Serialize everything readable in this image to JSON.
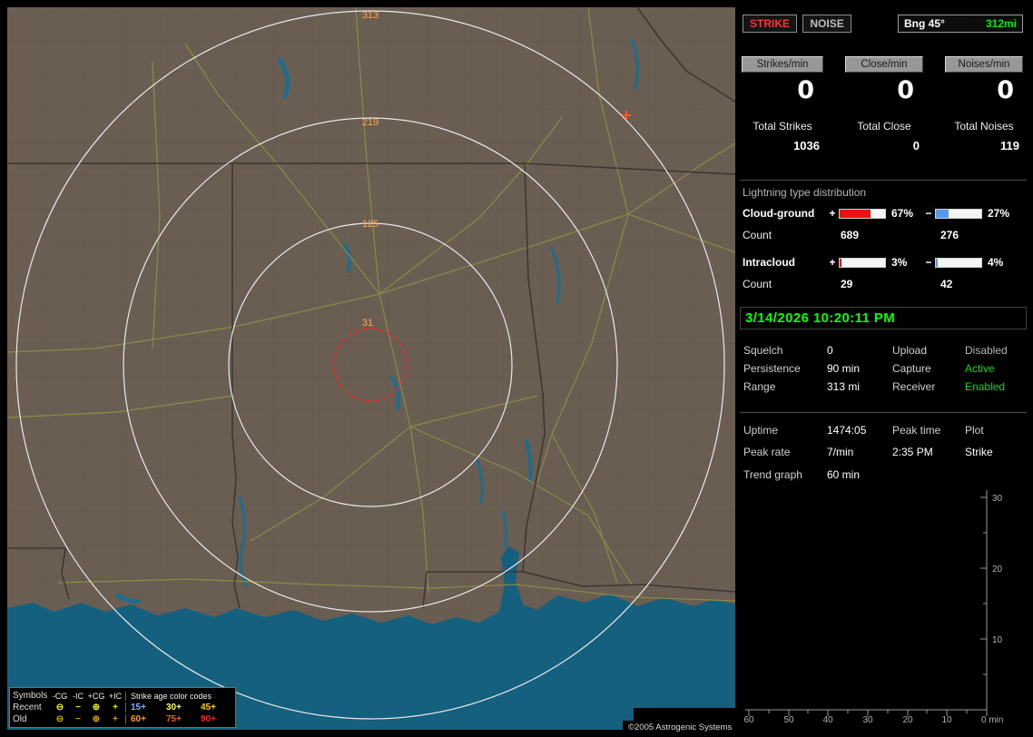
{
  "map": {
    "credit": "©2005 Astrogenic Systems",
    "rings": [
      {
        "label": "313"
      },
      {
        "label": "219"
      },
      {
        "label": "125"
      },
      {
        "label": "31"
      }
    ],
    "legend": {
      "symbols_title": "Symbols",
      "symbol_columns": [
        "-CG",
        "-IC",
        "+CG",
        "+IC"
      ],
      "symbols": {
        "neg_cg": "⊖",
        "neg_ic": "−",
        "pos_cg": "⊕",
        "pos_ic": "+"
      },
      "age_title": "Strike age color codes",
      "rows": [
        {
          "label": "Recent",
          "symbol_color": "#e8f000",
          "ages": [
            {
              "text": "15+",
              "color": "#7fb2ff"
            },
            {
              "text": "30+",
              "color": "#ffff55"
            },
            {
              "text": "45+",
              "color": "#ffcc00"
            }
          ]
        },
        {
          "label": "Old",
          "symbol_color": "#cfa400",
          "ages": [
            {
              "text": "60+",
              "color": "#ff9933"
            },
            {
              "text": "75+",
              "color": "#ff5533"
            },
            {
              "text": "90+",
              "color": "#ff2222"
            }
          ]
        }
      ]
    }
  },
  "panel": {
    "modes": [
      {
        "label": "STRIKE",
        "color": "#ff3333"
      },
      {
        "label": "NOISE",
        "color": "#bdbdbd"
      }
    ],
    "bearing": {
      "label": "Bng 45°",
      "range": "312mi",
      "range_color": "#00ee00"
    },
    "counters": [
      {
        "header": "Strikes/min",
        "rate": "0",
        "total_label": "Total Strikes",
        "total": "1036"
      },
      {
        "header": "Close/min",
        "rate": "0",
        "total_label": "Total Close",
        "total": "0"
      },
      {
        "header": "Noises/min",
        "rate": "0",
        "total_label": "Total Noises",
        "total": "119"
      }
    ],
    "distribution": {
      "title": "Lightning type distribution",
      "rows": [
        {
          "label": "Cloud-ground",
          "plus_sign": "+",
          "minus_sign": "−",
          "plus_pct": "67%",
          "plus_fill": 67,
          "plus_color": "#ee1111",
          "minus_pct": "27%",
          "minus_fill": 27,
          "minus_color": "#5599ee",
          "count_label": "Count",
          "plus_count": "689",
          "minus_count": "276"
        },
        {
          "label": "Intracloud",
          "plus_sign": "+",
          "minus_sign": "−",
          "plus_pct": "3%",
          "plus_fill": 3,
          "plus_color": "#ee1111",
          "minus_pct": "4%",
          "minus_fill": 4,
          "minus_color": "#5599ee",
          "count_label": "Count",
          "plus_count": "29",
          "minus_count": "42"
        }
      ]
    },
    "datetime": "3/14/2026 10:20:11 PM",
    "status": [
      {
        "label": "Squelch",
        "value": "0",
        "label2": "Upload",
        "value2": "Disabled",
        "value2_color": "#b5b5b5"
      },
      {
        "label": "Persistence",
        "value": "90 min",
        "label2": "Capture",
        "value2": "Active",
        "value2_color": "#00dd00"
      },
      {
        "label": "Range",
        "value": "313 mi",
        "label2": "Receiver",
        "value2": "Enabled",
        "value2_color": "#00dd00"
      }
    ],
    "stats": [
      {
        "label": "Uptime",
        "value": "1474:05",
        "label2": "Peak time",
        "value2": "Plot"
      },
      {
        "label": "Peak rate",
        "value": "7/min",
        "label2": "2:35 PM",
        "value2": "Strike"
      }
    ],
    "trend": {
      "label": "Trend graph",
      "window": "60 min",
      "y_ticks": [
        "30",
        "20",
        "10"
      ],
      "x_ticks": [
        "60",
        "50",
        "40",
        "30",
        "20",
        "10"
      ],
      "origin_label": "0 min"
    }
  }
}
